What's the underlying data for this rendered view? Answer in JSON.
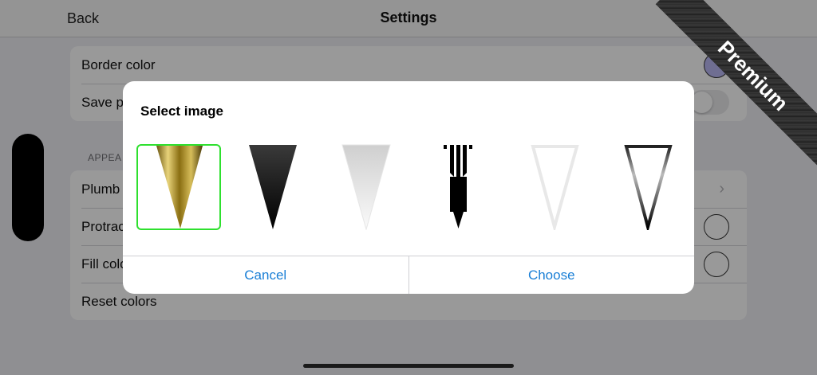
{
  "navbar": {
    "back_label": "Back",
    "title": "Settings"
  },
  "settings": {
    "group1": [
      {
        "label": "Border color",
        "control": "swatch",
        "color": "#b9b8f3"
      },
      {
        "label": "Save p",
        "control": "toggle"
      }
    ],
    "section_header": "APPEA",
    "group2": [
      {
        "label": "Plumb",
        "control": "chevron",
        "chevron": "›"
      },
      {
        "label": "Protrac",
        "control": "swatch-empty"
      },
      {
        "label": "Fill colo",
        "control": "swatch-empty"
      },
      {
        "label": "Reset colors",
        "control": "none"
      }
    ]
  },
  "ribbon": {
    "label": "Premium"
  },
  "dialog": {
    "title": "Select image",
    "options": [
      {
        "name": "gold-cone",
        "selected": true
      },
      {
        "name": "black-gradient-triangle",
        "selected": false
      },
      {
        "name": "white-gradient-triangle",
        "selected": false
      },
      {
        "name": "black-pen-nib",
        "selected": false
      },
      {
        "name": "white-outline-triangle",
        "selected": false
      },
      {
        "name": "black-outline-triangle",
        "selected": false
      }
    ],
    "cancel_label": "Cancel",
    "choose_label": "Choose"
  },
  "colors": {
    "selected_border": "#2ee02e",
    "accent": "#1a7fd6"
  }
}
